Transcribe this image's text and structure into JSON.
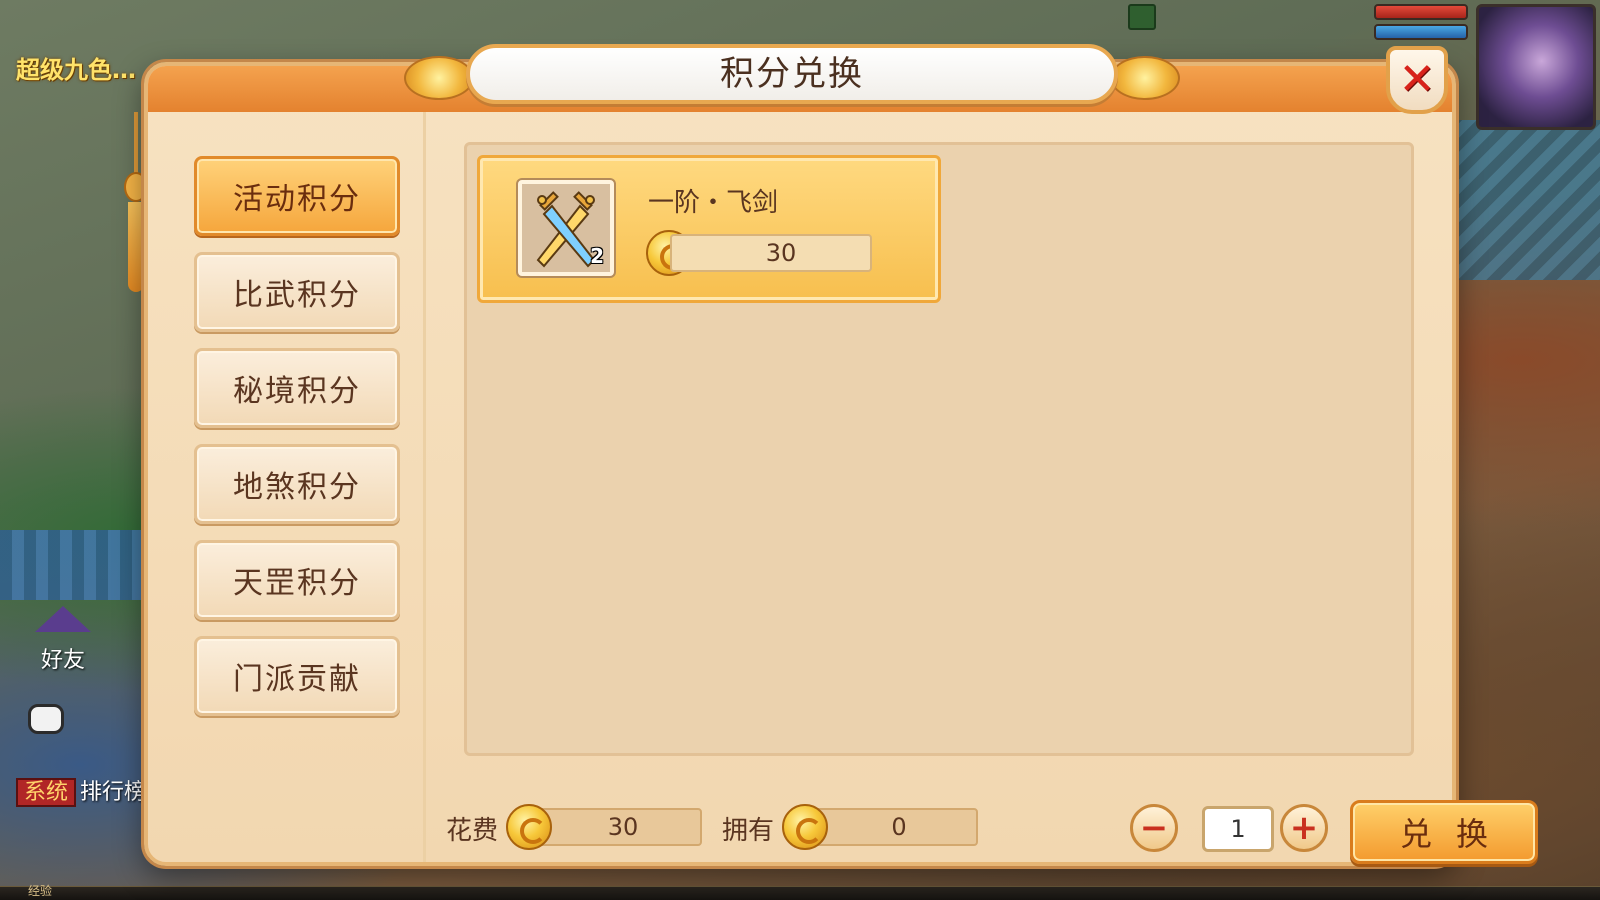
{
  "hud": {
    "title": "超级九色…",
    "friend_label": "好友",
    "system_tag": "系统",
    "chat_text": "排行榜",
    "exp_label": "经验"
  },
  "dialog": {
    "title": "积分兑换",
    "close_icon": "close-x-icon"
  },
  "tabs": [
    {
      "label": "活动积分",
      "active": true
    },
    {
      "label": "比武积分",
      "active": false
    },
    {
      "label": "秘境积分",
      "active": false
    },
    {
      "label": "地煞积分",
      "active": false
    },
    {
      "label": "天罡积分",
      "active": false
    },
    {
      "label": "门派贡献",
      "active": false
    }
  ],
  "items": [
    {
      "name": "一阶・飞剑",
      "price": "30",
      "count": "2",
      "icon": "crossed-swords-icon"
    }
  ],
  "footer": {
    "cost_label": "花费",
    "cost_value": "30",
    "own_label": "拥有",
    "own_value": "0",
    "quantity": "1",
    "minus_glyph": "−",
    "plus_glyph": "+",
    "exchange_label": "兑换"
  },
  "colors": {
    "accent": "#f5a63c",
    "panel": "#ebd2ae",
    "text": "#5a3520"
  }
}
